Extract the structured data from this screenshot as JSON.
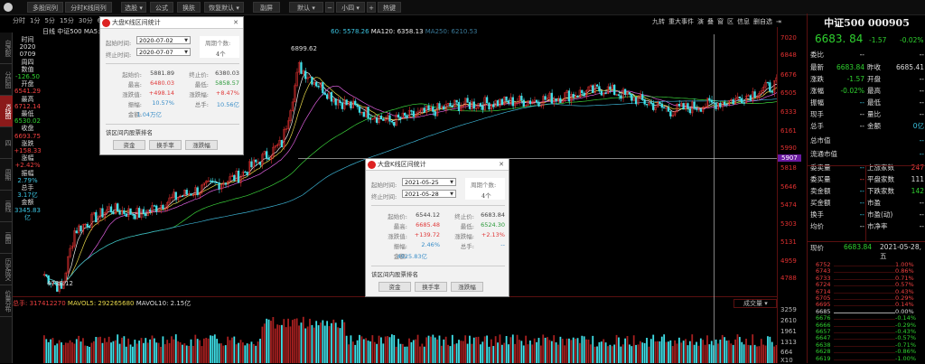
{
  "toolbar": {
    "buttons": [
      "多股同列",
      "分时K线同列",
      "选股 ▾",
      "公式",
      "换肤",
      "恢复默认 ▾",
      "副屏",
      "默认 ▾",
      "−",
      "小四 ▾",
      "+",
      "热键"
    ]
  },
  "period_tabs": [
    "分时",
    "1分",
    "5分",
    "15分",
    "30分",
    "60"
  ],
  "sidebar": [
    "自选股",
    "分时图",
    "K线图",
    "四",
    "周期",
    "画线",
    "画图",
    "历史成交",
    "价量分布"
  ],
  "info": {
    "period": "日线",
    "name": "中证500",
    "ma5": "MA5: 6392.11",
    "ma60": "60: 5578.26",
    "ma120": "MA120: 6358.13",
    "ma250": "MA250: 6210.53",
    "high_mark": "6899.62",
    "low_mark": "4736.12"
  },
  "datapanel": [
    [
      "时间",
      "w"
    ],
    [
      "2020",
      "w"
    ],
    [
      "0709",
      "w"
    ],
    [
      "周四",
      "w"
    ],
    [
      "数值",
      "w"
    ],
    [
      "-126.50",
      "g"
    ],
    [
      "开盘",
      "w"
    ],
    [
      "6541.29",
      "r"
    ],
    [
      "最高",
      "w"
    ],
    [
      "6712.14",
      "r"
    ],
    [
      "最低",
      "w"
    ],
    [
      "6530.02",
      "g"
    ],
    [
      "收盘",
      "w"
    ],
    [
      "6693.75",
      "r"
    ],
    [
      "涨跌",
      "w"
    ],
    [
      "+158.33",
      "r"
    ],
    [
      "涨幅",
      "w"
    ],
    [
      "+2.42%",
      "r"
    ],
    [
      "振幅",
      "w"
    ],
    [
      "2.79%",
      "c"
    ],
    [
      "总手",
      "w"
    ],
    [
      "3.17亿",
      "c"
    ],
    [
      "金额",
      "w"
    ],
    [
      "3345.83亿",
      "c"
    ]
  ],
  "chart_tools": [
    "九转",
    "重大事件",
    "演",
    "叠",
    "窗",
    "区",
    "信息",
    "删自选"
  ],
  "price_axis": [
    "7020",
    "6848",
    "6676",
    "6505",
    "6333",
    "6161",
    "5990",
    "5907",
    "5818",
    "5646",
    "5474",
    "5303",
    "5131",
    "4959",
    "4788"
  ],
  "vol_axis": [
    "3259",
    "2610",
    "1961",
    "1313",
    "664",
    "X10"
  ],
  "volume": {
    "total": "总手: 317412270",
    "mavol5": "MAVOL5: 292265680",
    "mavol10": "MAVOL10: 2.15亿",
    "selector": "成交量"
  },
  "dialogs": [
    {
      "title": "大盘K线区间统计",
      "start_label": "起始时间:",
      "start": "2020-07-02",
      "end_label": "终止时间:",
      "end": "2020-07-07",
      "periods_label": "周期个数:",
      "periods": "4个",
      "start_price": "5881.89",
      "end_price": "6380.03",
      "high": "6480.03",
      "low": "5858.57",
      "change": "+498.14",
      "change_pct": "+8.47%",
      "amplitude": "10.57%",
      "volume": "10.56亿",
      "amount": "1.04万亿",
      "labels": {
        "start_price": "起始价:",
        "end_price": "终止价:",
        "high": "最高:",
        "low": "最低:",
        "change": "涨跌值:",
        "change_pct": "涨跌幅:",
        "amplitude": "振幅:",
        "volume": "总手:",
        "amount": "金额:"
      },
      "ranking": "该区间内股票排名",
      "buttons": [
        "资金",
        "换手率",
        "涨跌幅"
      ]
    },
    {
      "title": "大盘K线区间统计",
      "start_label": "起始时间:",
      "start": "2021-05-25",
      "end_label": "终止时间:",
      "end": "2021-05-28",
      "periods_label": "周期个数:",
      "periods": "4个",
      "start_price": "6544.12",
      "end_price": "6683.84",
      "high": "6685.48",
      "low": "6524.30",
      "change": "+139.72",
      "change_pct": "+2.13%",
      "amplitude": "2.46%",
      "volume": "--",
      "amount": "4925.83亿",
      "labels": {
        "start_price": "起始价:",
        "end_price": "终止价:",
        "high": "最高:",
        "low": "最低:",
        "change": "涨跌值:",
        "change_pct": "涨跌幅:",
        "amplitude": "振幅:",
        "volume": "总手:",
        "amount": "金额:"
      },
      "ranking": "该区间内股票排名",
      "buttons": [
        "资金",
        "换手率",
        "涨跌幅"
      ]
    }
  ],
  "quote": {
    "title": "中证500 000905",
    "price": "6683. 84",
    "change": "-1.57",
    "pct": "-0.02%",
    "rows": [
      [
        [
          "委比",
          "w"
        ],
        [
          "--",
          "w"
        ],
        [
          "",
          "w"
        ],
        [
          "--",
          "w"
        ]
      ],
      [
        [
          "最新",
          "w"
        ],
        [
          "6683.84",
          "g"
        ],
        [
          "昨收",
          "w"
        ],
        [
          "6685.41",
          "w"
        ]
      ],
      [
        [
          "涨跌",
          "w"
        ],
        [
          "-1.57",
          "g"
        ],
        [
          "开盘",
          "w"
        ],
        [
          "--",
          "w"
        ]
      ],
      [
        [
          "涨幅",
          "w"
        ],
        [
          "-0.02%",
          "g"
        ],
        [
          "最高",
          "w"
        ],
        [
          "--",
          "w"
        ]
      ],
      [
        [
          "振幅",
          "w"
        ],
        [
          "--",
          "c"
        ],
        [
          "最低",
          "w"
        ],
        [
          "--",
          "w"
        ]
      ],
      [
        [
          "现手",
          "w"
        ],
        [
          "--",
          "w"
        ],
        [
          "量比",
          "w"
        ],
        [
          "--",
          "w"
        ]
      ],
      [
        [
          "总手",
          "w"
        ],
        [
          "--",
          "w"
        ],
        [
          "金额",
          "w"
        ],
        [
          "0亿",
          "c"
        ]
      ],
      [
        [
          "总市值",
          "w"
        ],
        [
          "",
          "w"
        ],
        [
          "",
          "w"
        ],
        [
          "--",
          "c"
        ]
      ],
      [
        [
          "流通市值",
          "w"
        ],
        [
          "",
          "w"
        ],
        [
          "",
          "w"
        ],
        [
          "--",
          "c"
        ]
      ],
      [
        [
          "委卖量",
          "w"
        ],
        [
          "--",
          "c"
        ],
        [
          "上涨家数",
          "w"
        ],
        [
          "247",
          "r"
        ]
      ],
      [
        [
          "委买量",
          "w"
        ],
        [
          "--",
          "r"
        ],
        [
          "平盘家数",
          "w"
        ],
        [
          "111",
          "w"
        ]
      ],
      [
        [
          "卖金额",
          "w"
        ],
        [
          "--",
          "c"
        ],
        [
          "下跌家数",
          "w"
        ],
        [
          "142",
          "g"
        ]
      ],
      [
        [
          "买金额",
          "w"
        ],
        [
          "--",
          "c"
        ],
        [
          "市盈",
          "w"
        ],
        [
          "--",
          "w"
        ]
      ],
      [
        [
          "换手",
          "w"
        ],
        [
          "--",
          "c"
        ],
        [
          "市盈(动)",
          "w"
        ],
        [
          "--",
          "w"
        ]
      ],
      [
        [
          "均价",
          "w"
        ],
        [
          "--",
          "w"
        ],
        [
          "市净率",
          "w"
        ],
        [
          "--",
          "w"
        ]
      ]
    ],
    "now_label": "现价",
    "now_price": "6683.84",
    "now_date": "2021-05-28,五"
  },
  "ladder": [
    [
      "6752",
      "1.00%",
      "r"
    ],
    [
      "6743",
      "0.86%",
      "r"
    ],
    [
      "6733",
      "0.71%",
      "r"
    ],
    [
      "6724",
      "0.57%",
      "r"
    ],
    [
      "6714",
      "0.43%",
      "r"
    ],
    [
      "6705",
      "0.29%",
      "r"
    ],
    [
      "6695",
      "0.14%",
      "r"
    ],
    [
      "6685",
      "0.00%",
      "w"
    ],
    [
      "6676",
      "-0.14%",
      "g"
    ],
    [
      "6666",
      "-0.29%",
      "g"
    ],
    [
      "6657",
      "-0.43%",
      "g"
    ],
    [
      "6647",
      "-0.57%",
      "g"
    ],
    [
      "6638",
      "-0.71%",
      "g"
    ],
    [
      "6628",
      "-0.86%",
      "g"
    ],
    [
      "6619",
      "-1.00%",
      "g"
    ]
  ]
}
